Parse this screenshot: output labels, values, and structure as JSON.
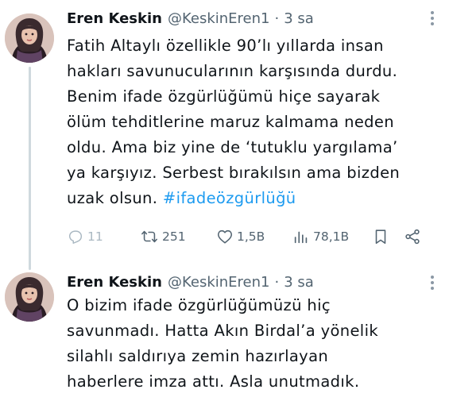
{
  "tweets": [
    {
      "author": {
        "name": "Eren Keskin",
        "handle": "@KeskinEren1",
        "time": "3 sa",
        "separator": "·"
      },
      "text_lines": [
        "Fatih Altaylı özellikle 90’lı yıllarda insan",
        "hakları savunucularının karşısında durdu.",
        "Benim ifade özgürlüğümü hiçe sayarak",
        "ölüm tehditlerine maruz kalmama neden",
        "oldu. Ama biz yine de ‘tutuklu yargılama’",
        "ya karşıyız. Serbest bırakılsın ama bizden"
      ],
      "last_line_text": "uzak olsun.",
      "hashtag": "#ifadeözgürlüğü",
      "metrics": {
        "replies": "11",
        "retweets": "251",
        "likes": "1,5B",
        "views": "78,1B"
      }
    },
    {
      "author": {
        "name": "Eren Keskin",
        "handle": "@KeskinEren1",
        "time": "3 sa",
        "separator": "·"
      },
      "text_lines": [
        "O bizim ifade özgürlüğümüzü hiç",
        "savunmadı. Hatta Akın Birdal’a yönelik",
        "silahlı saldırıya zemin hazırlayan",
        "haberlere imza attı. Asla unutmadık."
      ]
    }
  ],
  "icons": {
    "reply": "reply-icon",
    "retweet": "retweet-icon",
    "like": "heart-icon",
    "views": "views-icon",
    "bookmark": "bookmark-icon",
    "share": "share-icon",
    "more": "more-icon"
  },
  "colors": {
    "text": "#0f1419",
    "secondary": "#536471",
    "link": "#1d9bf0",
    "thread_line": "#cfd9de"
  }
}
